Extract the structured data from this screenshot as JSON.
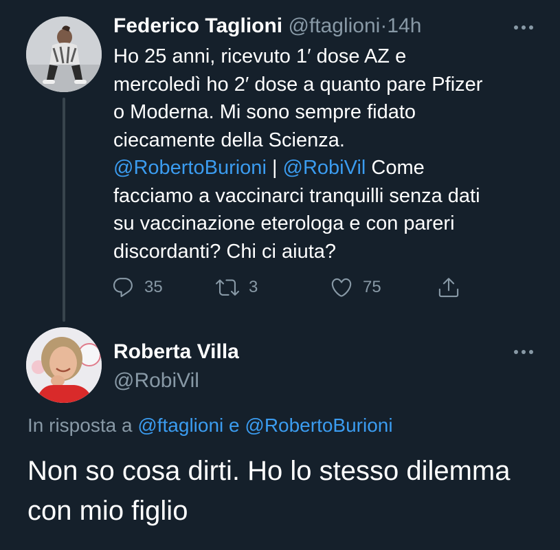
{
  "parent_tweet": {
    "display_name": "Federico Taglioni",
    "handle": "@ftaglioni",
    "separator": "·",
    "time": "14h",
    "text_part1": "Ho 25 anni, ricevuto 1′ dose AZ e\nmercoledì ho 2′ dose a quanto pare Pfizer\no Moderna. Mi sono sempre fidato\nciecamente della Scienza.\n",
    "mention_1": "@RobertoBurioni",
    "pipe": " | ",
    "mention_2": "@RobiVil",
    "text_part2": " Come\nfacciamo a vaccinarci tranquilli senza dati\nsu vaccinazione eterologa e con pareri\ndiscordanti? Chi ci aiuta?",
    "reply_count": "35",
    "retweet_count": "3",
    "like_count": "75",
    "icons": [
      "reply-icon",
      "retweet-icon",
      "like-icon",
      "share-icon",
      "more-icon"
    ]
  },
  "reply_tweet": {
    "display_name": "Roberta Villa",
    "handle": "@RobiVil",
    "in_reply_prefix": "In risposta a ",
    "in_reply_user_1": "@ftaglioni",
    "in_reply_and": " e ",
    "in_reply_user_2": "@RobertoBurioni",
    "text": "Non so cosa dirti. Ho lo stesso dilemma con mio figlio"
  },
  "colors": {
    "background": "#15202b",
    "text": "#ffffff",
    "secondary": "#8899a6",
    "link": "#3b9cf0",
    "thread_line": "#38444d"
  }
}
